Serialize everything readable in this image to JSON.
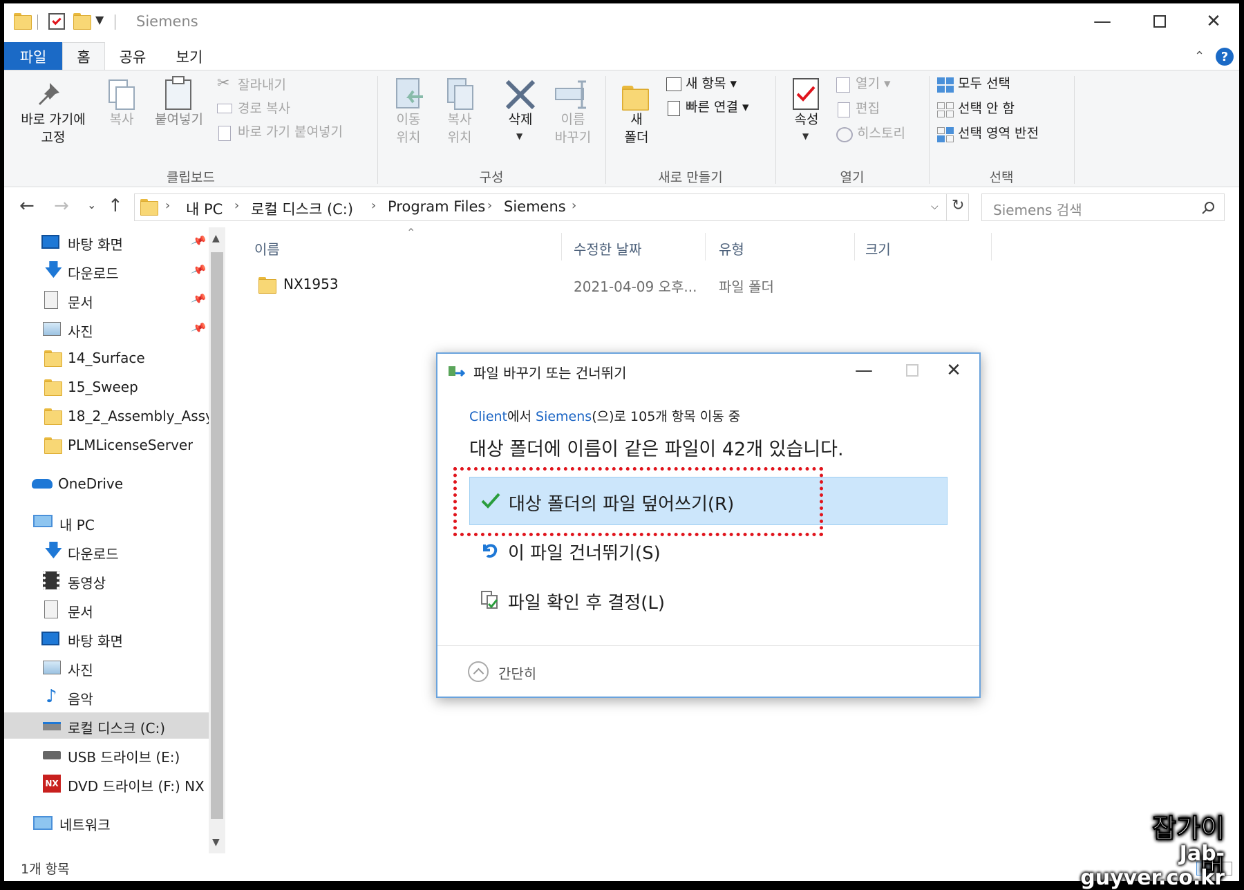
{
  "window": {
    "title": "Siemens"
  },
  "ribbon_tabs": [
    "파일",
    "홈",
    "공유",
    "보기"
  ],
  "ribbon": {
    "clipboard": {
      "pin_label_1": "바로 가기에",
      "pin_label_2": "고정",
      "copy": "복사",
      "paste": "붙여넣기",
      "cut": "잘라내기",
      "copy_path": "경로 복사",
      "paste_shortcut": "바로 가기 붙여넣기",
      "group": "클립보드"
    },
    "organize": {
      "move_1": "이동",
      "move_2": "위치",
      "copy_1": "복사",
      "copy_2": "위치",
      "delete": "삭제",
      "rename_1": "이름",
      "rename_2": "바꾸기",
      "group": "구성"
    },
    "new": {
      "folder_1": "새",
      "folder_2": "폴더",
      "new_item": "새 항목",
      "easy_access": "빠른 연결",
      "group": "새로 만들기"
    },
    "open": {
      "properties": "속성",
      "open": "열기",
      "edit": "편집",
      "history": "히스토리",
      "group": "열기"
    },
    "select": {
      "select_all": "모두 선택",
      "select_none": "선택 안 함",
      "invert": "선택 영역 반전",
      "group": "선택"
    }
  },
  "address": {
    "crumbs": [
      "내 PC",
      "로컬 디스크 (C:)",
      "Program Files",
      "Siemens"
    ],
    "search_placeholder": "Siemens 검색"
  },
  "sidebar": {
    "quick": [
      "바탕 화면",
      "다운로드",
      "문서",
      "사진",
      "14_Surface",
      "15_Sweep",
      "18_2_Assembly_Assy",
      "PLMLicenseServer"
    ],
    "onedrive": "OneDrive",
    "pc": "내 PC",
    "pc_items": [
      "다운로드",
      "동영상",
      "문서",
      "바탕 화면",
      "사진",
      "음악",
      "로컬 디스크 (C:)",
      "USB 드라이브 (E:)",
      "DVD 드라이브 (F:) NX"
    ],
    "network": "네트워크"
  },
  "filelist": {
    "columns": [
      "이름",
      "수정한 날짜",
      "유형",
      "크기"
    ],
    "rows": [
      {
        "name": "NX1953",
        "date": "2021-04-09 오후...",
        "type": "파일 폴더",
        "size": ""
      }
    ]
  },
  "status": {
    "count": "1개 항목"
  },
  "dialog": {
    "title": "파일 바꾸기 또는 건너뛰기",
    "source": "Client",
    "from_suffix": "에서 ",
    "dest": "Siemens",
    "progress_suffix": "(으)로 105개 항목 이동 중",
    "headline": "대상 폴더에 이름이 같은 파일이 42개 있습니다.",
    "options": [
      "대상 폴더의 파일 덮어쓰기(R)",
      "이 파일 건너뛰기(S)",
      "파일 확인 후 결정(L)"
    ],
    "footer": "간단히"
  },
  "watermark": {
    "line1": "잡가이버",
    "line2": "Jab-guyver.co.kr"
  },
  "colors": {
    "accent": "#1b6ac6",
    "highlight": "#cce6fb",
    "callout": "#e0141c"
  }
}
